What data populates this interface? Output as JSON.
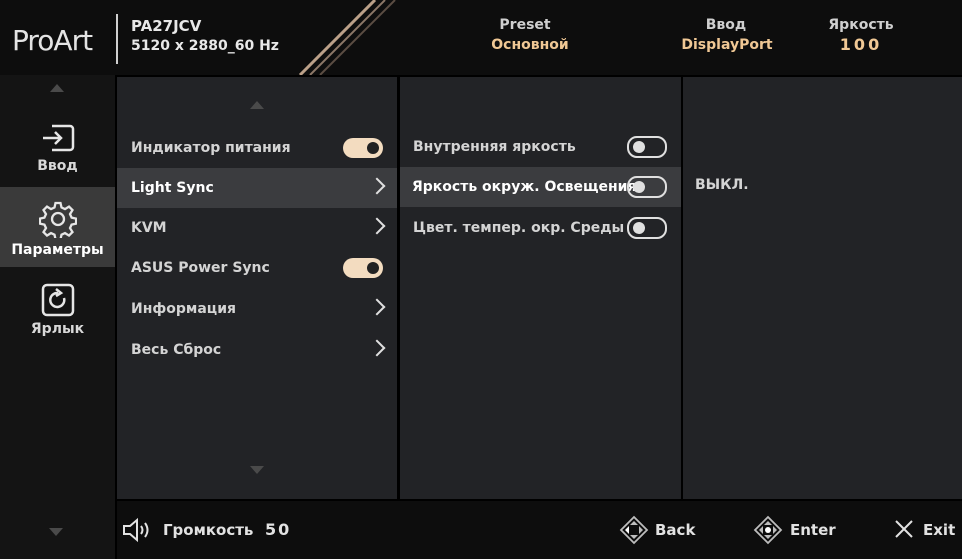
{
  "header": {
    "logo": "ProArt",
    "model": "PA27JCV",
    "resolution": "5120 x 2880_60 Hz",
    "preset_label": "Preset",
    "preset_value": "Основной",
    "input_label": "Ввод",
    "input_value": "DisplayPort",
    "brightness_label": "Яркость",
    "brightness_value": "100",
    "value_color": "#f0c895"
  },
  "sidebar": {
    "items": [
      {
        "label": "Ввод",
        "icon": "input-icon",
        "selected": false
      },
      {
        "label": "Параметры",
        "icon": "gear-icon",
        "selected": true
      },
      {
        "label": "Ярлык",
        "icon": "shortcut-icon",
        "selected": false
      }
    ]
  },
  "menu": {
    "items": [
      {
        "label": "Индикатор питания",
        "control": "toggle",
        "state": "on"
      },
      {
        "label": "Light Sync",
        "control": "submenu",
        "selected": true
      },
      {
        "label": "KVM",
        "control": "submenu"
      },
      {
        "label": "ASUS Power Sync",
        "control": "toggle",
        "state": "on"
      },
      {
        "label": "Информация",
        "control": "submenu"
      },
      {
        "label": "Весь Сброс",
        "control": "submenu"
      }
    ]
  },
  "submenu": {
    "items": [
      {
        "label": "Внутренняя яркость",
        "control": "toggle",
        "state": "off"
      },
      {
        "label": "Яркость окруж. Освещения",
        "control": "toggle",
        "state": "off",
        "selected": true
      },
      {
        "label": "Цвет. темпер. окр. Среды",
        "control": "toggle",
        "state": "off"
      }
    ]
  },
  "detail": {
    "value": "ВЫКЛ."
  },
  "footer": {
    "volume_label": "Громкость",
    "volume_value": "50",
    "back_label": "Back",
    "enter_label": "Enter",
    "exit_label": "Exit"
  }
}
